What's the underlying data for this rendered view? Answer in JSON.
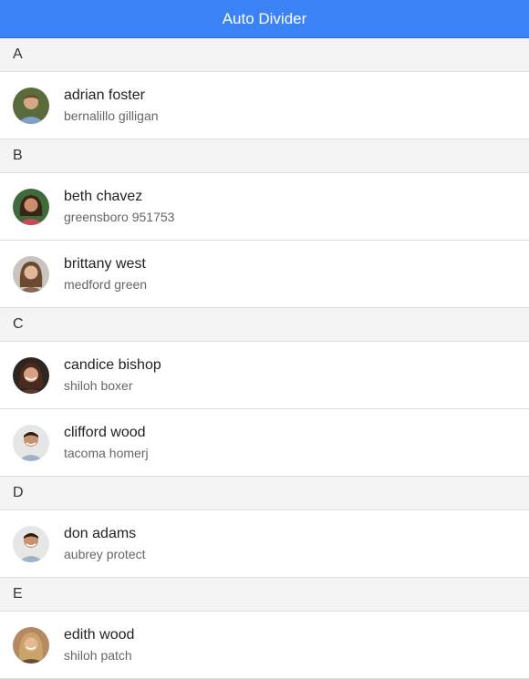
{
  "header": {
    "title": "Auto Divider"
  },
  "colors": {
    "header_bg": "#3b82f6",
    "divider_bg": "#f4f4f4"
  },
  "list": [
    {
      "type": "divider",
      "label": "A"
    },
    {
      "type": "item",
      "name": "adrian foster",
      "sub": "bernalillo gilligan",
      "avatar": "avatar-male-1"
    },
    {
      "type": "divider",
      "label": "B"
    },
    {
      "type": "item",
      "name": "beth chavez",
      "sub": "greensboro 951753",
      "avatar": "avatar-female-1"
    },
    {
      "type": "item",
      "name": "brittany west",
      "sub": "medford green",
      "avatar": "avatar-female-2"
    },
    {
      "type": "divider",
      "label": "C"
    },
    {
      "type": "item",
      "name": "candice bishop",
      "sub": "shiloh boxer",
      "avatar": "avatar-female-3"
    },
    {
      "type": "item",
      "name": "clifford wood",
      "sub": "tacoma homerj",
      "avatar": "avatar-male-2"
    },
    {
      "type": "divider",
      "label": "D"
    },
    {
      "type": "item",
      "name": "don adams",
      "sub": "aubrey protect",
      "avatar": "avatar-male-2"
    },
    {
      "type": "divider",
      "label": "E"
    },
    {
      "type": "item",
      "name": "edith wood",
      "sub": "shiloh patch",
      "avatar": "avatar-female-4"
    }
  ]
}
